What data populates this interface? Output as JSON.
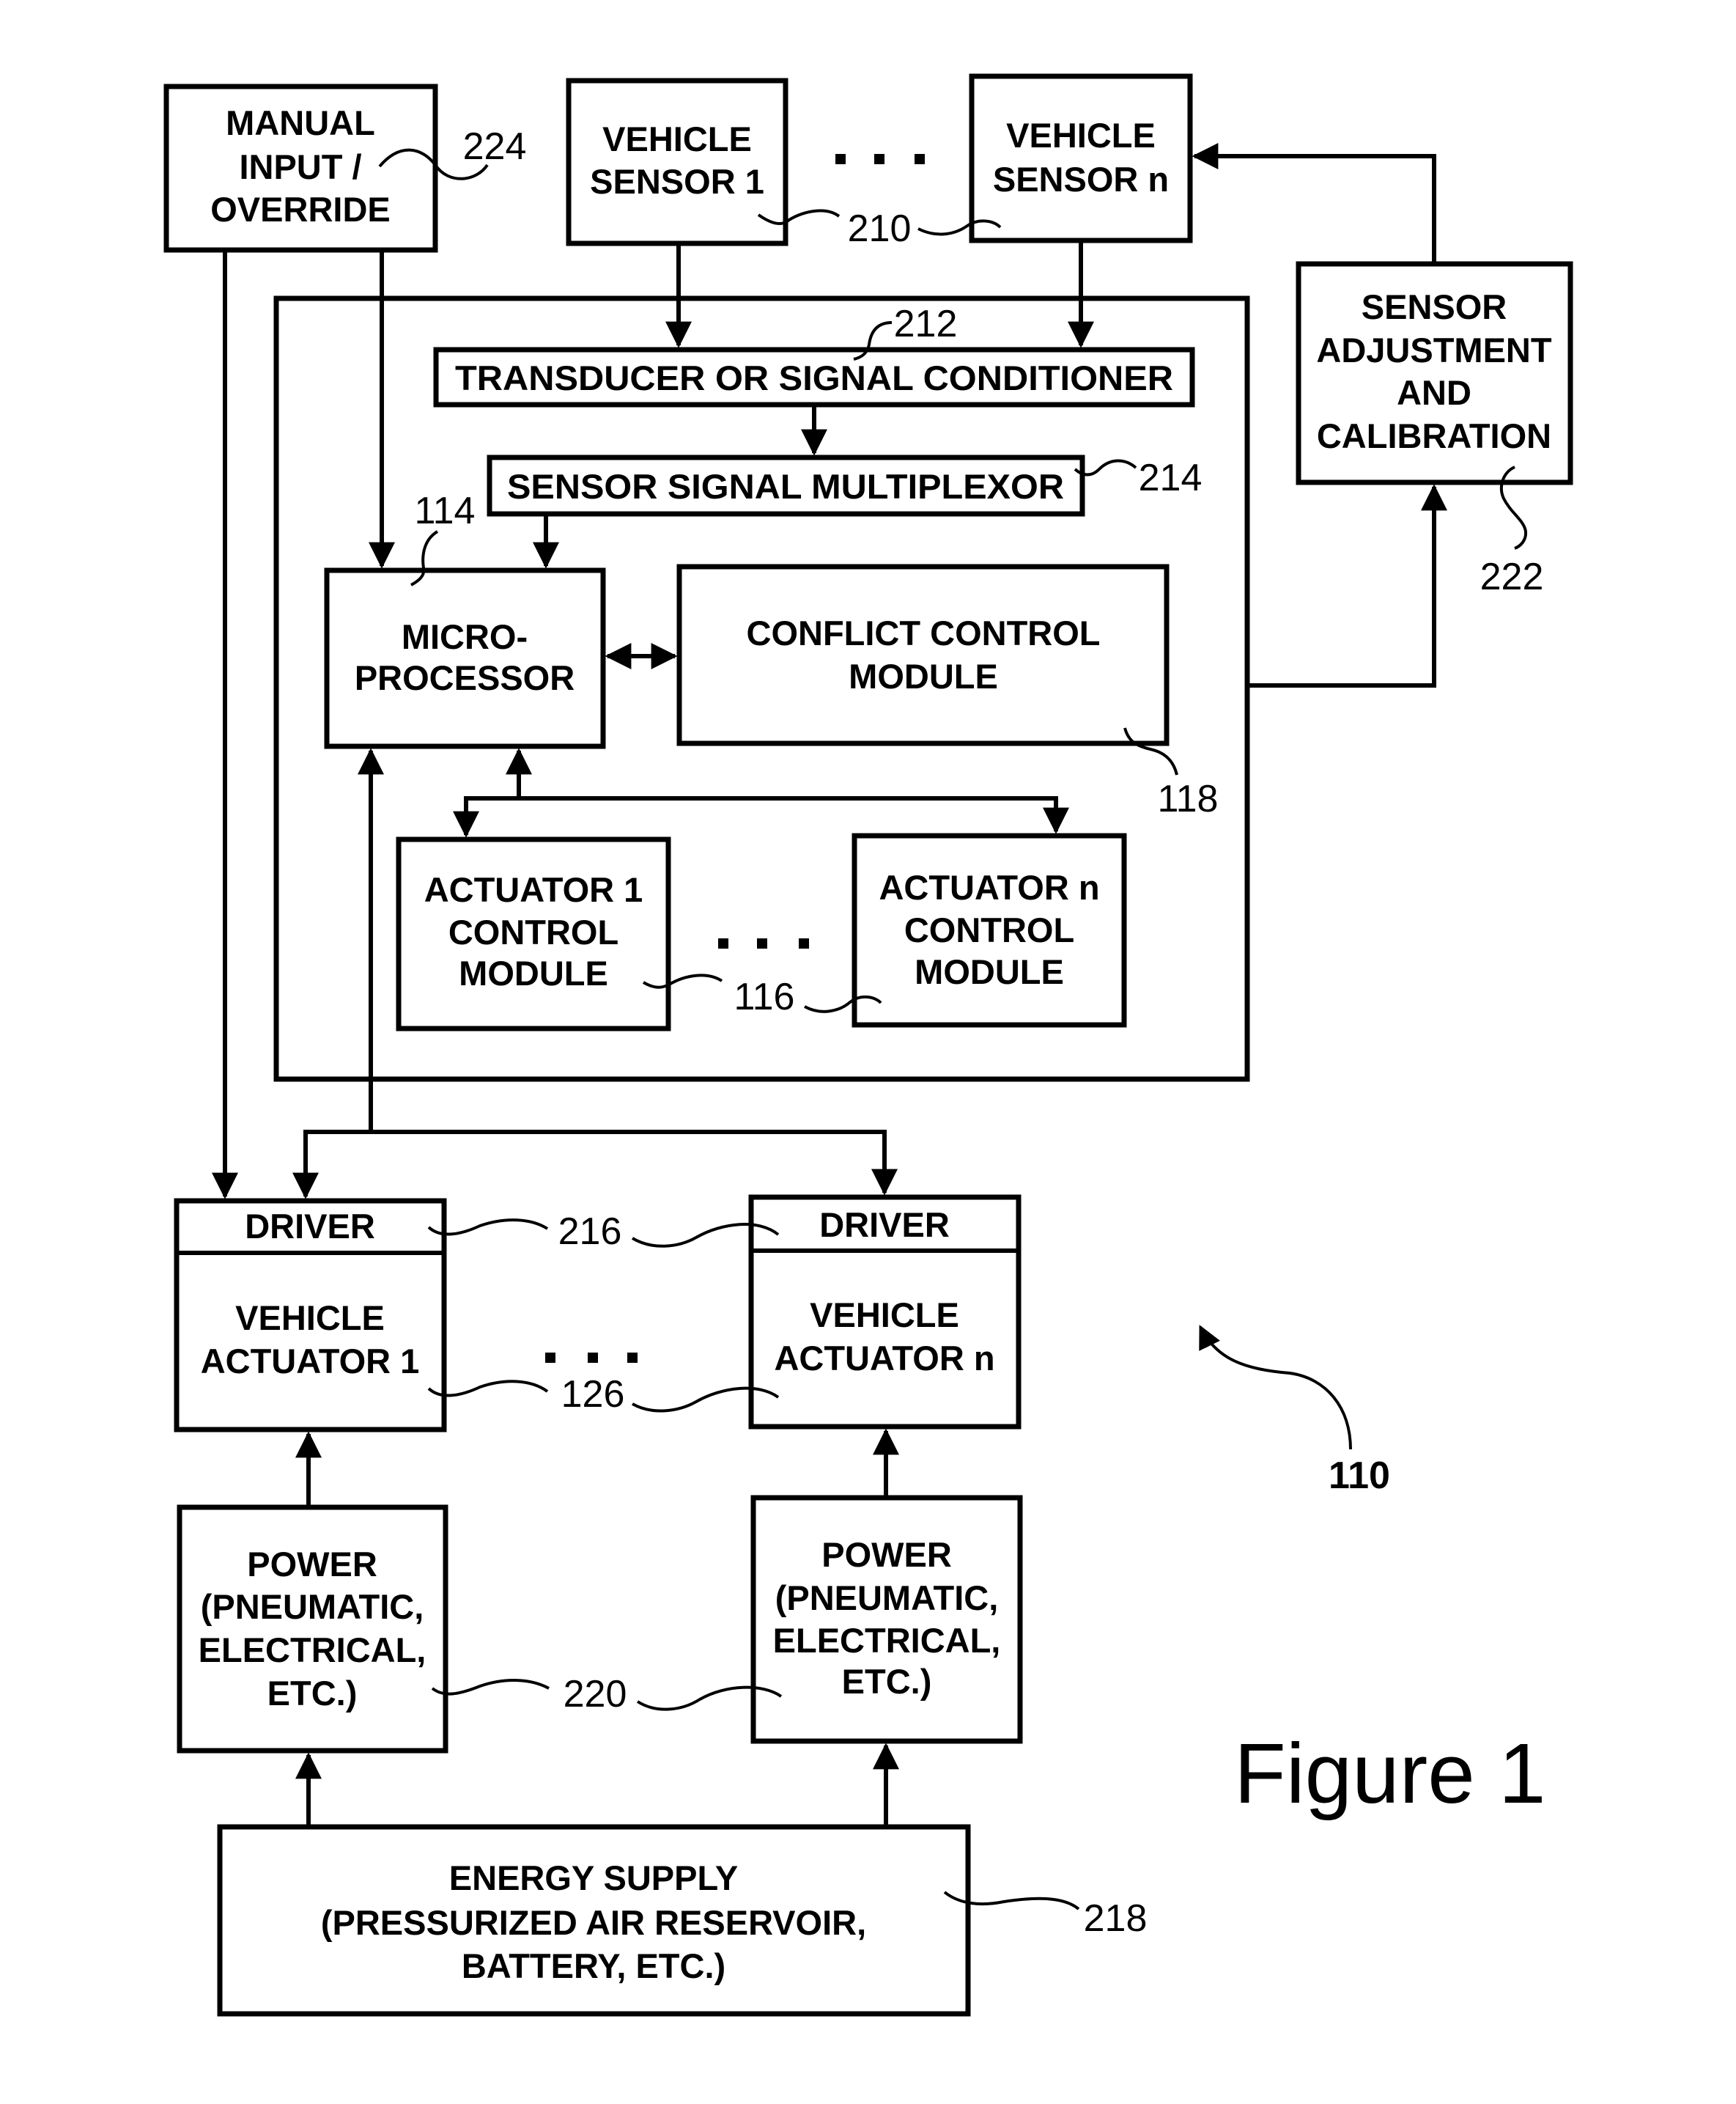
{
  "figure": {
    "title": "Figure 1",
    "system_reference": "110"
  },
  "boxes": {
    "manual_input": {
      "lines": [
        "MANUAL",
        "INPUT /",
        "OVERRIDE"
      ],
      "ref": "224"
    },
    "vehicle_sensor_1": {
      "lines": [
        "VEHICLE",
        "SENSOR 1"
      ]
    },
    "vehicle_sensor_n": {
      "lines": [
        "VEHICLE",
        "SENSOR n"
      ]
    },
    "vehicle_sensors_ref": "210",
    "sensor_adjustment": {
      "lines": [
        "SENSOR",
        "ADJUSTMENT",
        "AND",
        "CALIBRATION"
      ],
      "ref": "222"
    },
    "transducer": {
      "lines": [
        "TRANSDUCER OR SIGNAL CONDITIONER"
      ],
      "ref": "212"
    },
    "multiplexor": {
      "lines": [
        "SENSOR SIGNAL MULTIPLEXOR"
      ],
      "ref": "214"
    },
    "microprocessor": {
      "lines": [
        "MICRO-",
        "PROCESSOR"
      ],
      "ref": "114"
    },
    "conflict_control": {
      "lines": [
        "CONFLICT CONTROL",
        "MODULE"
      ],
      "ref": "118"
    },
    "actuator_1_control": {
      "lines": [
        "ACTUATOR 1",
        "CONTROL",
        "MODULE"
      ]
    },
    "actuator_n_control": {
      "lines": [
        "ACTUATOR n",
        "CONTROL",
        "MODULE"
      ]
    },
    "actuator_control_ref": "116",
    "vehicle_actuator_1": {
      "driver": "DRIVER",
      "lines": [
        "VEHICLE",
        "ACTUATOR 1"
      ]
    },
    "vehicle_actuator_n": {
      "driver": "DRIVER",
      "lines": [
        "VEHICLE",
        "ACTUATOR n"
      ]
    },
    "driver_ref": "216",
    "vehicle_actuator_ref": "126",
    "power_1": {
      "lines": [
        "POWER",
        "(PNEUMATIC,",
        "ELECTRICAL,",
        "ETC.)"
      ]
    },
    "power_n": {
      "lines": [
        "POWER",
        "(PNEUMATIC,",
        "ELECTRICAL,",
        "ETC.)"
      ]
    },
    "power_ref": "220",
    "energy_supply": {
      "lines": [
        "ENERGY SUPPLY",
        "(PRESSURIZED AIR RESERVOIR,",
        "BATTERY, ETC.)"
      ],
      "ref": "218"
    }
  },
  "ellipsis": "..."
}
